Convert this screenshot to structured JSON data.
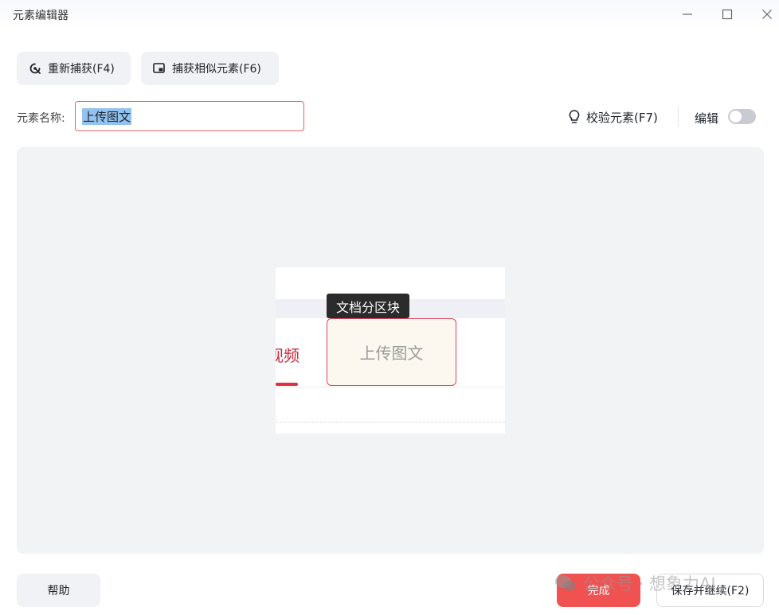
{
  "window": {
    "title": "元素编辑器"
  },
  "toolbar": {
    "recapture_label": "重新捕获(F4)",
    "capture_similar_label": "捕获相似元素(F6)"
  },
  "element_name": {
    "label": "元素名称:",
    "value": "上传图文"
  },
  "verify": {
    "label": "校验元素(F7)"
  },
  "edit": {
    "label": "编辑",
    "enabled": false
  },
  "preview": {
    "partial_tab_text": "视频",
    "tag_label": "文档分区块",
    "element_text": "上传图文"
  },
  "footer": {
    "help_label": "帮助",
    "done_label": "完成",
    "save_continue_label": "保存并继续(F2)"
  },
  "watermark": {
    "text": "公众号 · 想象力AI"
  },
  "colors": {
    "accent": "#f05252",
    "highlight_border": "#d9475a"
  }
}
